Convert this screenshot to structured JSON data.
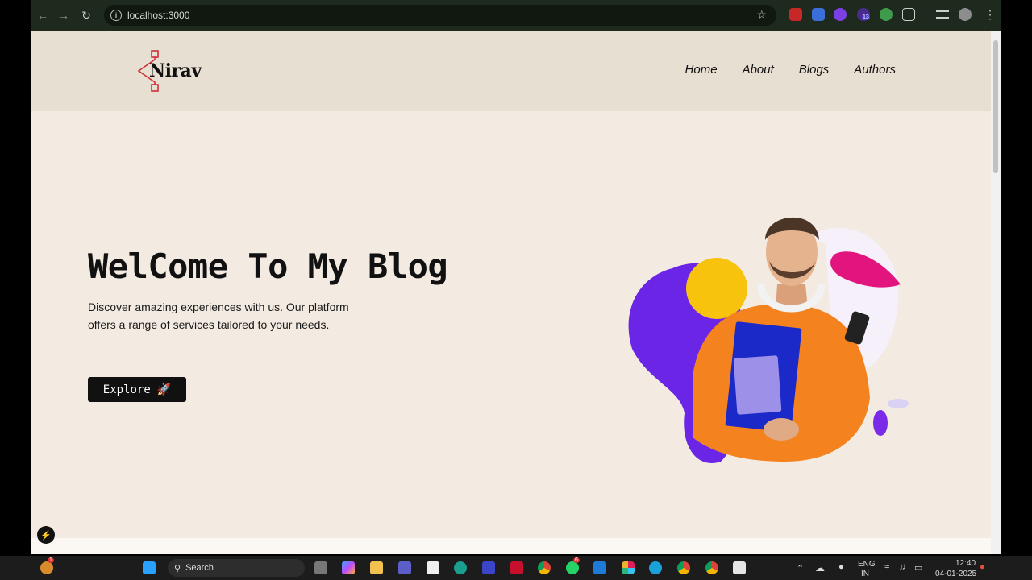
{
  "browser": {
    "url": "localhost:3000"
  },
  "site": {
    "logo_text": "Nirav",
    "nav": [
      "Home",
      "About",
      "Blogs",
      "Authors"
    ],
    "hero": {
      "title": "WelCome To My Blog",
      "description": "Discover amazing experiences with us. Our platform offers a range of services tailored to your needs.",
      "button_label": "Explore",
      "button_emoji": "🚀"
    }
  },
  "taskbar": {
    "search_label": "Search",
    "lang_top": "ENG",
    "lang_bottom": "IN",
    "time": "12:40",
    "date": "04-01-2025",
    "badges": {
      "whatsapp": "6",
      "extension": "13",
      "widget": "1"
    }
  }
}
